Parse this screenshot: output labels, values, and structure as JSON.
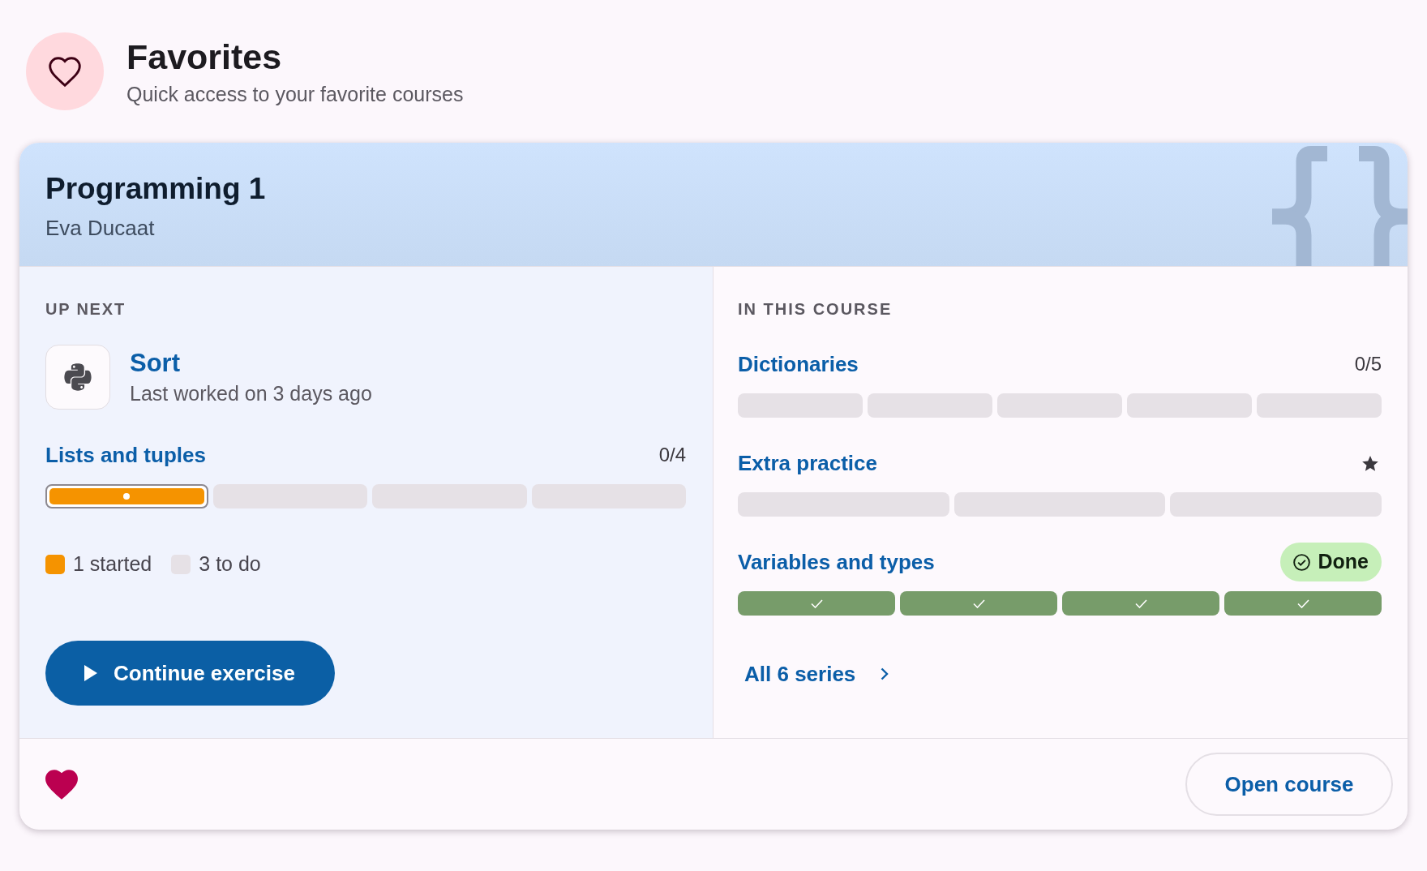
{
  "header": {
    "title": "Favorites",
    "subtitle": "Quick access to your favorite courses"
  },
  "course": {
    "title": "Programming 1",
    "teacher": "Eva Ducaat",
    "up_next": {
      "heading": "UP NEXT",
      "exercise": {
        "title": "Sort",
        "subtitle": "Last worked on 3 days ago"
      },
      "series": {
        "title": "Lists and tuples",
        "count": "0/4",
        "segments": [
          {
            "kind": "started",
            "current": true
          },
          {
            "kind": "todo",
            "current": false
          },
          {
            "kind": "todo",
            "current": false
          },
          {
            "kind": "todo",
            "current": false
          }
        ]
      },
      "legend": [
        {
          "kind": "started",
          "label": "1 started"
        },
        {
          "kind": "todo",
          "label": "3 to do"
        }
      ],
      "button": "Continue exercise"
    },
    "in_this_course": {
      "heading": "IN THIS COURSE",
      "series": [
        {
          "kind": "count",
          "title": "Dictionaries",
          "count": "0/5",
          "segments": [
            {
              "kind": "todo"
            },
            {
              "kind": "todo"
            },
            {
              "kind": "todo"
            },
            {
              "kind": "todo"
            },
            {
              "kind": "todo"
            }
          ]
        },
        {
          "kind": "starred",
          "title": "Extra practice",
          "segments": [
            {
              "kind": "todo"
            },
            {
              "kind": "todo"
            },
            {
              "kind": "todo"
            }
          ]
        },
        {
          "kind": "done",
          "title": "Variables and types",
          "badge": "Done",
          "segments": [
            {
              "kind": "done"
            },
            {
              "kind": "done"
            },
            {
              "kind": "done"
            },
            {
              "kind": "done"
            }
          ]
        }
      ],
      "link": "All 6 series"
    },
    "favorite": true,
    "open_button": "Open course"
  }
}
